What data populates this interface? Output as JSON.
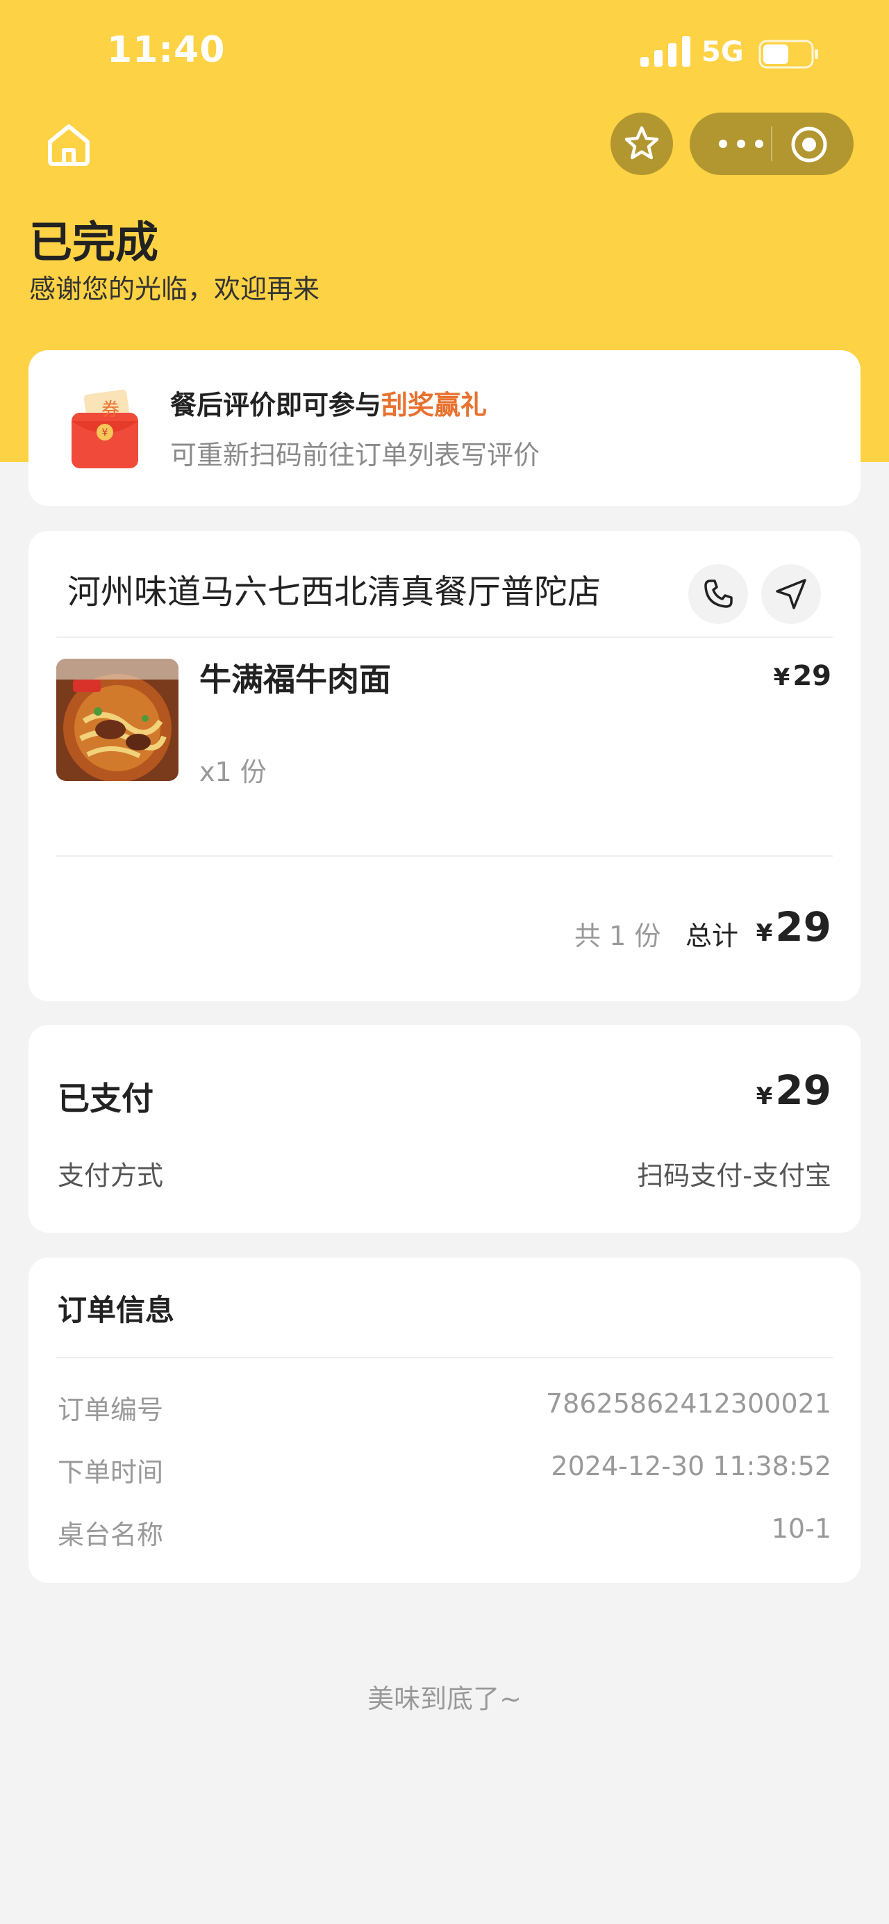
{
  "status_bar": {
    "time": "11:40",
    "network": "5G",
    "battery_level": 0.55
  },
  "nav": {
    "home": "home-icon",
    "favorite": "star-icon",
    "more": "more-icon",
    "close": "target-icon"
  },
  "header": {
    "title": "已完成",
    "subtitle": "感谢您的光临，欢迎再来"
  },
  "promo": {
    "icon_text": "券",
    "title_prefix": "餐后评价即可参与",
    "title_highlight": "刮奖赢礼",
    "subtitle": "可重新扫码前往订单列表写评价",
    "highlight_color": "#e8712f"
  },
  "order": {
    "shop_name": "河州味道马六七西北清真餐厅普陀店",
    "item": {
      "name": "牛满福牛肉面",
      "currency": "¥",
      "price": "29",
      "qty": "x1 份"
    },
    "count": "共 1 份",
    "total_label": "总计",
    "currency": "¥",
    "total": "29"
  },
  "payment": {
    "status": "已支付",
    "currency": "¥",
    "amount": "29",
    "method_label": "支付方式",
    "method_value": "扫码支付-支付宝"
  },
  "info": {
    "title": "订单信息",
    "rows": [
      {
        "label": "订单编号",
        "value": "78625862412300021"
      },
      {
        "label": "下单时间",
        "value": "2024-12-30 11:38:52"
      },
      {
        "label": "桌台名称",
        "value": "10-1"
      }
    ]
  },
  "footer": "美味到底了~",
  "colors": {
    "brand_yellow": "#fdd244",
    "nav_button": "#b2962f",
    "page_bg": "#f3f3f3"
  }
}
